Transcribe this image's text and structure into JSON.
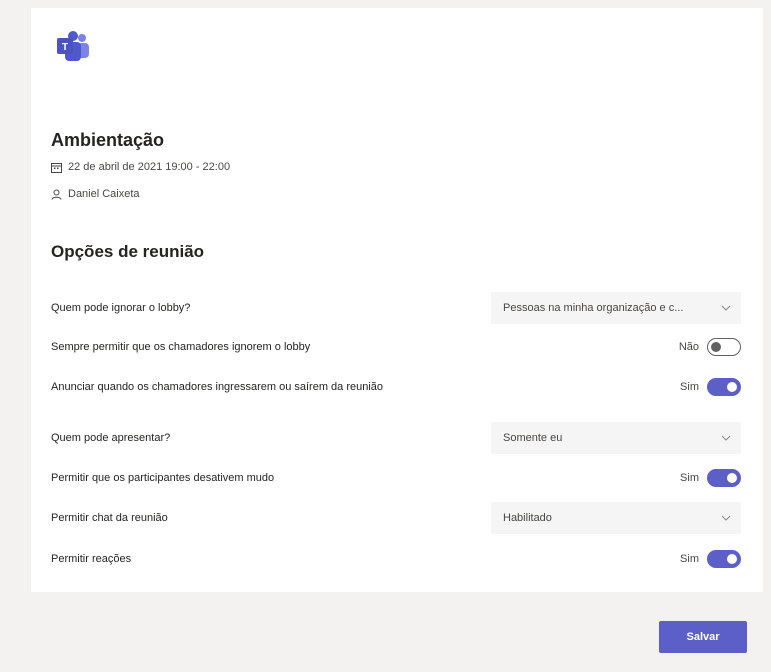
{
  "meeting": {
    "title": "Ambientação",
    "datetime": "22 de abril de 2021 19:00 - 22:00",
    "organizer": "Daniel Caixeta"
  },
  "options_title": "Opções de reunião",
  "options": [
    {
      "label": "Quem pode ignorar o lobby?",
      "control": "select",
      "value": "Pessoas na minha organização e c..."
    },
    {
      "label": "Sempre permitir que os chamadores ignorem o lobby",
      "control": "toggle",
      "state_text": "Não",
      "on": false
    },
    {
      "label": "Anunciar quando os chamadores ingressarem ou saírem da reunião",
      "control": "toggle",
      "state_text": "Sim",
      "on": true
    },
    {
      "label": "Quem pode apresentar?",
      "control": "select",
      "value": "Somente eu"
    },
    {
      "label": "Permitir que os participantes desativem mudo",
      "control": "toggle",
      "state_text": "Sim",
      "on": true
    },
    {
      "label": "Permitir chat da reunião",
      "control": "select",
      "value": "Habilitado"
    },
    {
      "label": "Permitir reações",
      "control": "toggle",
      "state_text": "Sim",
      "on": true
    }
  ],
  "save_label": "Salvar",
  "colors": {
    "accent": "#5b5fc7",
    "background": "#f3f2f1",
    "card": "#ffffff"
  },
  "icons": {
    "logo": "teams-logo",
    "calendar": "calendar-icon",
    "person": "person-icon",
    "dropdown": "chevron-down-icon"
  }
}
